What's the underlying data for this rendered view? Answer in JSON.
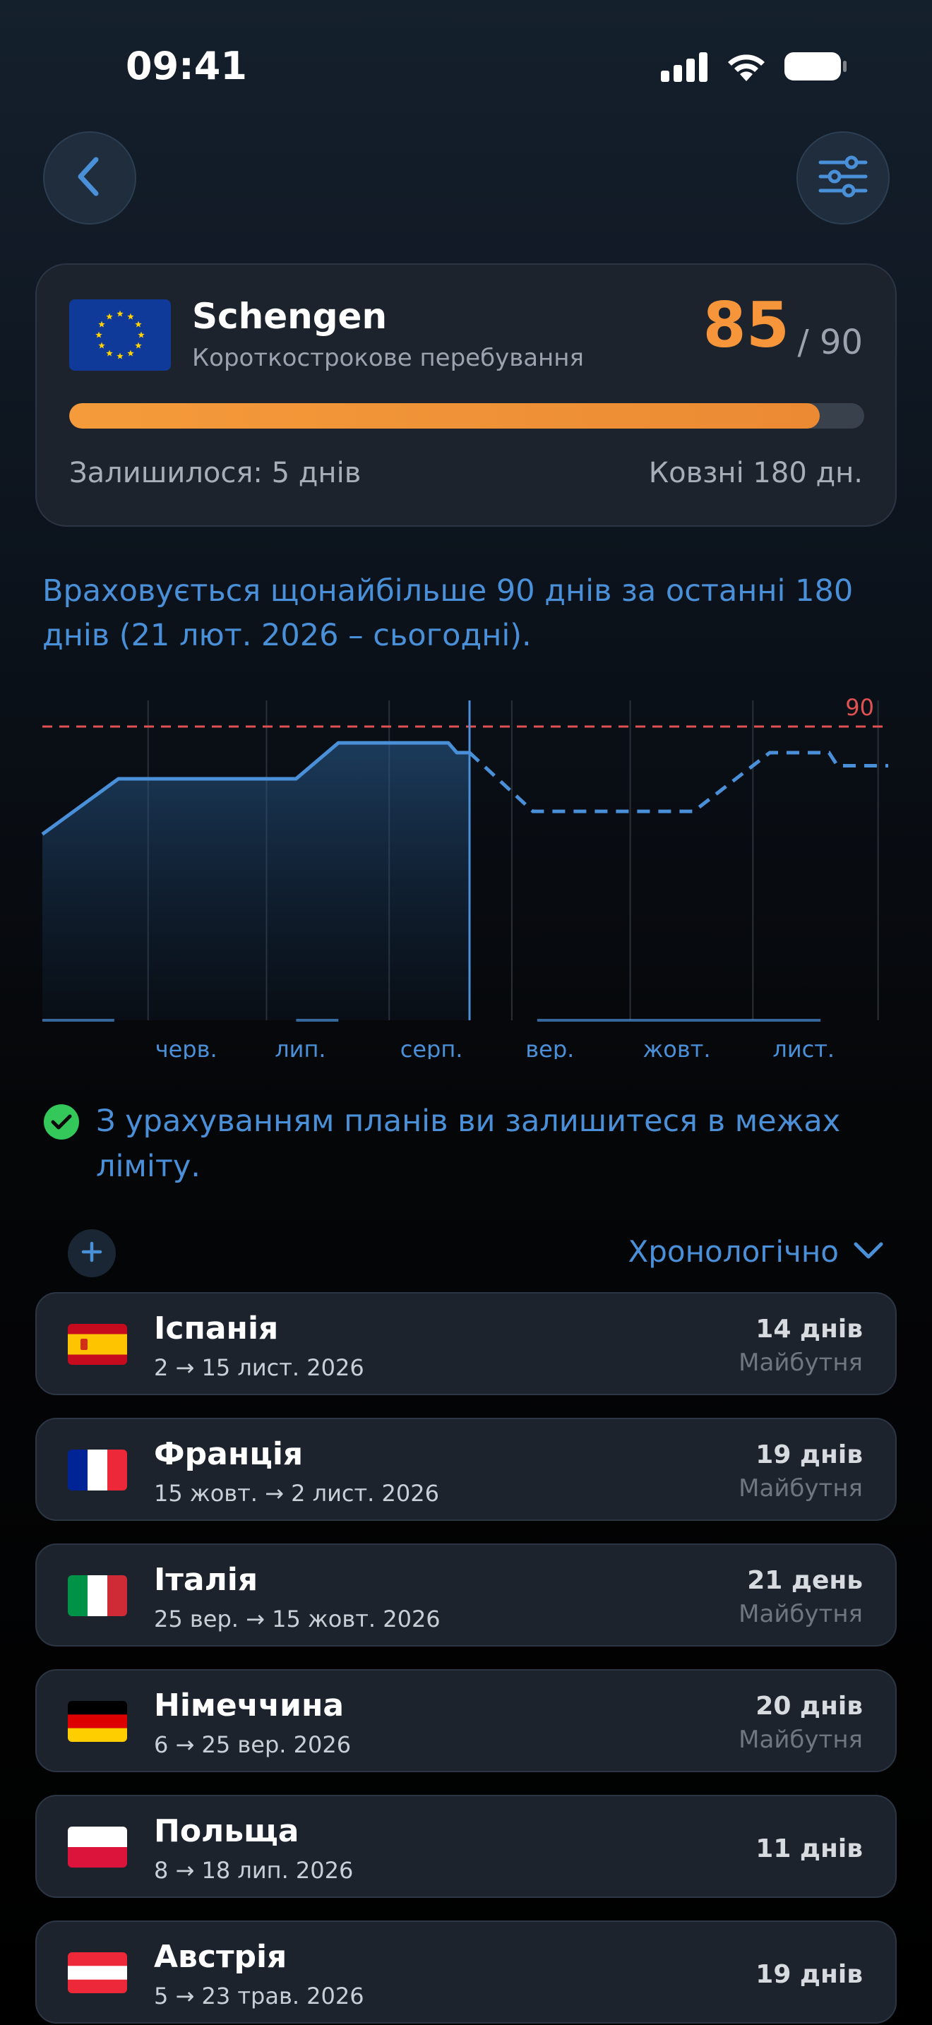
{
  "status_bar": {
    "time": "09:41"
  },
  "summary": {
    "zone_name": "Schengen",
    "zone_subtitle": "Короткострокове перебування",
    "days_used": "85",
    "days_limit": "/ 90",
    "progress_fraction": 0.944,
    "remaining_text": "Залишилося: 5 днів",
    "rolling_text": "Ковзні 180 дн."
  },
  "info_text": "Враховується щонайбільше 90 днів за останні 180 днів (21 лют. 2026 – сьогодні).",
  "chart_data": {
    "type": "line",
    "x_tick_labels": [
      "черв.",
      "лип.",
      "серп.",
      "вер.",
      "жовт.",
      "лист."
    ],
    "limit_label": "90",
    "limit_value": 90,
    "ylim": [
      0,
      98
    ],
    "series": [
      {
        "style": "solid-area",
        "points": [
          [
            0,
            57
          ],
          [
            0.09,
            74
          ],
          [
            0.3,
            74
          ],
          [
            0.35,
            85
          ],
          [
            0.48,
            85
          ],
          [
            0.49,
            82
          ],
          [
            0.505,
            82
          ]
        ]
      },
      {
        "style": "dashed",
        "points": [
          [
            0.505,
            82
          ],
          [
            0.58,
            64
          ],
          [
            0.77,
            64
          ],
          [
            0.86,
            82
          ],
          [
            0.93,
            82
          ],
          [
            0.94,
            78
          ],
          [
            1.0,
            78
          ]
        ]
      }
    ],
    "today_fraction": 0.505,
    "colors": {
      "line": "#4a90d9",
      "limit": "#e05252",
      "grid": "#2a3038",
      "label": "#4a90d9"
    }
  },
  "plan_status_text": "З урахуванням планів ви залишитеся в межах ліміту.",
  "sort_label": "Хронологічно",
  "trips": [
    {
      "country": "Іспанія",
      "dates": "2 → 15 лист. 2026",
      "days": "14 днів",
      "status": "Майбутня",
      "flag": "spain"
    },
    {
      "country": "Франція",
      "dates": "15 жовт. → 2 лист. 2026",
      "days": "19 днів",
      "status": "Майбутня",
      "flag": "france"
    },
    {
      "country": "Італія",
      "dates": "25 вер. → 15 жовт. 2026",
      "days": "21 день",
      "status": "Майбутня",
      "flag": "italy"
    },
    {
      "country": "Німеччина",
      "dates": "6 → 25 вер. 2026",
      "days": "20 днів",
      "status": "Майбутня",
      "flag": "germany"
    },
    {
      "country": "Польща",
      "dates": "8 → 18 лип. 2026",
      "days": "11 днів",
      "status": "",
      "flag": "poland"
    },
    {
      "country": "Австрія",
      "dates": "5 → 23 трав. 2026",
      "days": "19 днів",
      "status": "",
      "flag": "austria"
    }
  ]
}
